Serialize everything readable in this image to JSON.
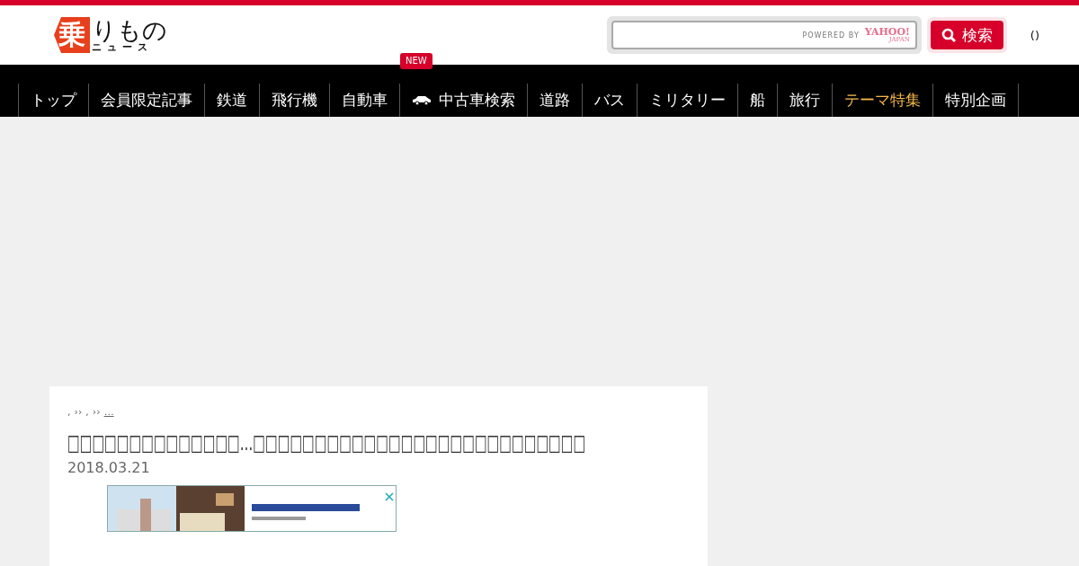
{
  "logo": {
    "mark": "乗",
    "word": "りもの",
    "sub": "ニュース"
  },
  "search": {
    "powered_by": "POWERED BY",
    "provider": "YAHOO!",
    "provider_sub": "JAPAN",
    "button": "検索"
  },
  "header_link": "()",
  "nav": [
    {
      "label": "トップ",
      "highlighted": false
    },
    {
      "label": "会員限定記事",
      "highlighted": false
    },
    {
      "label": "鉄道",
      "highlighted": false
    },
    {
      "label": "飛行機",
      "highlighted": false
    },
    {
      "label": "自動車",
      "highlighted": false
    },
    {
      "label": "中古車検索",
      "highlighted": false,
      "kind": "car",
      "badge": "NEW"
    },
    {
      "label": "道路",
      "highlighted": false
    },
    {
      "label": "バス",
      "highlighted": false
    },
    {
      "label": "ミリタリー",
      "highlighted": false
    },
    {
      "label": "船",
      "highlighted": false
    },
    {
      "label": "旅行",
      "highlighted": false
    },
    {
      "label": "テーマ特集",
      "highlighted": true
    },
    {
      "label": "特別企画",
      "highlighted": false
    }
  ],
  "article": {
    "breadcrumb": [
      {
        "text": ",",
        "link": false
      },
      {
        "text": "››",
        "link": false
      },
      {
        "text": ",",
        "link": false
      },
      {
        "text": "››",
        "link": false
      },
      {
        "text": "…",
        "link": true
      }
    ],
    "title": "□□□□□□□□□□□□□□…□□□□□□□□□□□□□□□□□□□□□□□□□□□",
    "date": "2018.03.21"
  }
}
